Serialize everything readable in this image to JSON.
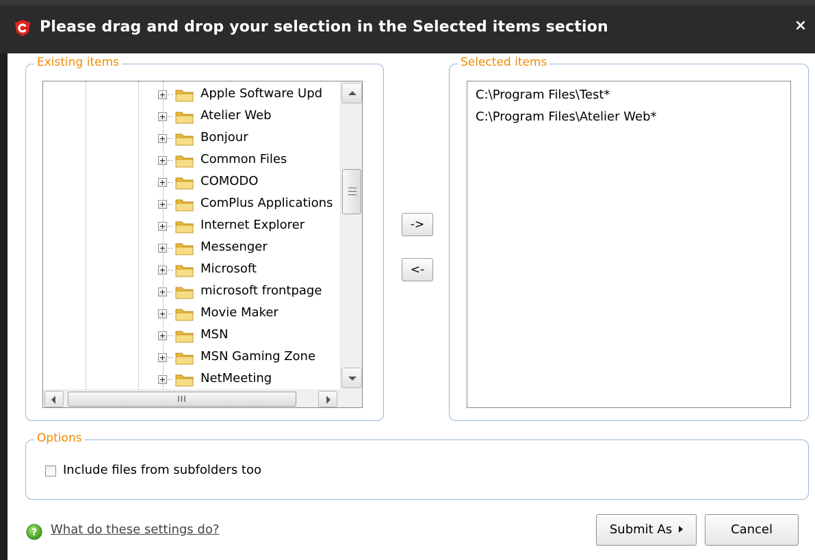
{
  "window": {
    "title": "Please drag and drop your selection in the Selected items section",
    "close_label": "×"
  },
  "existing": {
    "legend": "Existing items",
    "tree_items": [
      {
        "label": "Apple Software Upd"
      },
      {
        "label": "Atelier Web"
      },
      {
        "label": "Bonjour"
      },
      {
        "label": "Common Files"
      },
      {
        "label": "COMODO"
      },
      {
        "label": "ComPlus Applications"
      },
      {
        "label": "Internet Explorer"
      },
      {
        "label": "Messenger"
      },
      {
        "label": "Microsoft"
      },
      {
        "label": "microsoft frontpage"
      },
      {
        "label": "Movie Maker"
      },
      {
        "label": "MSN"
      },
      {
        "label": "MSN Gaming Zone"
      },
      {
        "label": "NetMeeting"
      }
    ],
    "hscroll_grip": "III"
  },
  "move": {
    "add_label": "->",
    "remove_label": "<-"
  },
  "selected": {
    "legend": "Selected items",
    "items": [
      "C:\\Program Files\\Test*",
      "C:\\Program Files\\Atelier Web*"
    ]
  },
  "options": {
    "legend": "Options",
    "include_subfolders_label": "Include files from subfolders too",
    "include_subfolders_checked": false
  },
  "footer": {
    "help_link": "What do these settings do?",
    "submit_label": "Submit As",
    "cancel_label": "Cancel"
  },
  "colors": {
    "titlebar": "#2b2b2b",
    "legend_orange": "#f08a00",
    "group_border": "#9ab6d4",
    "logo_red": "#e0231b",
    "folder_yellow": "#f2c94c"
  }
}
